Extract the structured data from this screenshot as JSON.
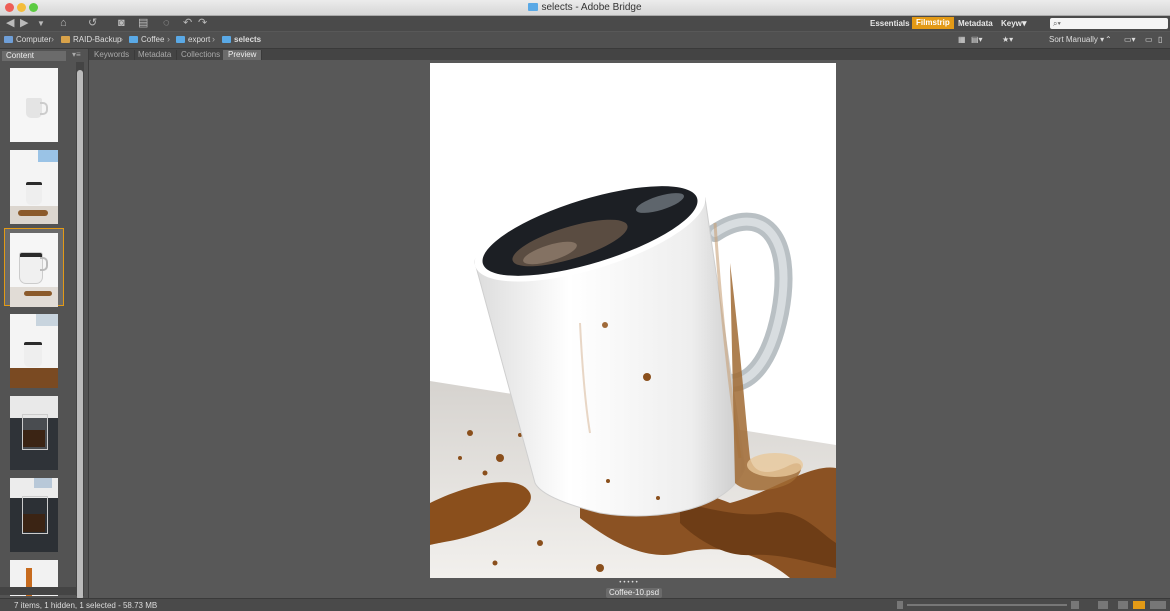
{
  "window": {
    "title": "selects - Adobe Bridge"
  },
  "toolbar": {
    "workspaces": [
      "Essentials",
      "Filmstrip",
      "Metadata",
      "Keyw"
    ],
    "active_workspace": "Filmstrip",
    "search_placeholder": "⌕▾"
  },
  "breadcrumbs": [
    {
      "label": "Computer"
    },
    {
      "label": "RAID-Backup"
    },
    {
      "label": "Coffee"
    },
    {
      "label": "export"
    },
    {
      "label": "selects"
    }
  ],
  "pathbar_right": {
    "sort_label": "Sort Manually"
  },
  "left_panel": {
    "tab_label": "Content"
  },
  "center_tabs": [
    "Keywords",
    "Metadata",
    "Collections",
    "Preview"
  ],
  "active_center_tab": "Preview",
  "preview": {
    "filename": "Coffee-10.psd",
    "rating_dots": "•••••"
  },
  "thumbnails": [
    {
      "name": "thumb-1",
      "selected": false
    },
    {
      "name": "thumb-2",
      "selected": false
    },
    {
      "name": "thumb-3",
      "selected": true
    },
    {
      "name": "thumb-4",
      "selected": false
    },
    {
      "name": "thumb-5",
      "selected": false
    },
    {
      "name": "thumb-6",
      "selected": false
    },
    {
      "name": "thumb-7",
      "selected": false
    }
  ],
  "status": {
    "text": "7 items, 1 hidden, 1 selected - 58.73 MB"
  },
  "colors": {
    "accent": "#e39a16",
    "folder": "#5aa9e6"
  }
}
